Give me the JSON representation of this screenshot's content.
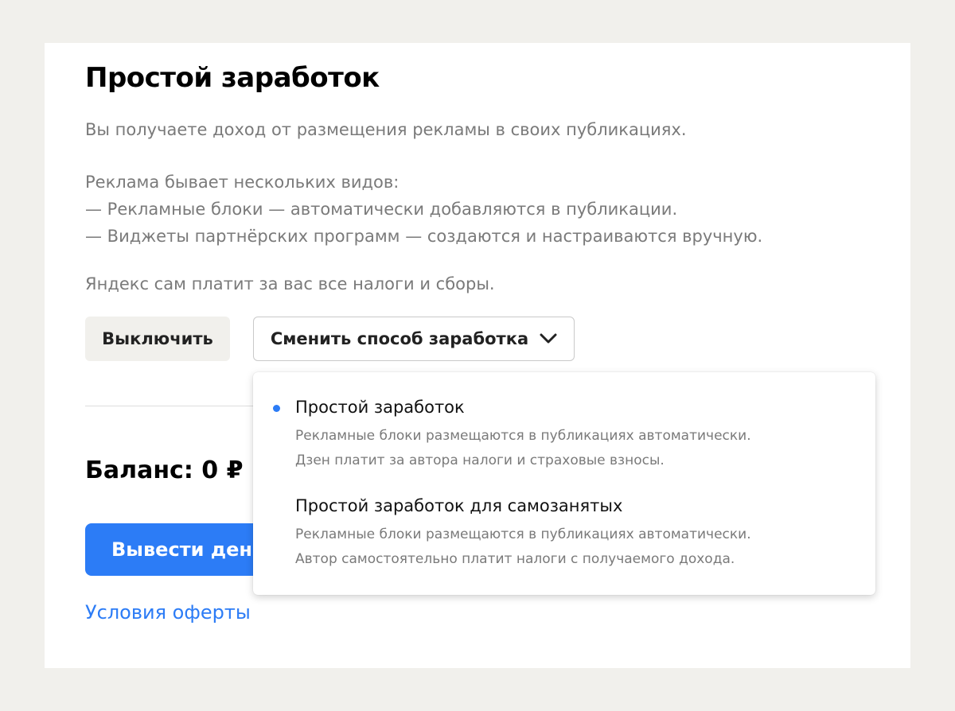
{
  "title": "Простой заработок",
  "description": {
    "intro": "Вы получаете доход от размещения рекламы в своих публикациях.",
    "types_heading": "Реклама бывает нескольких видов:",
    "type_1": "— Рекламные блоки — автоматически добавляются в публикации.",
    "type_2": "— Виджеты партнёрских программ — создаются и настраиваются вручную.",
    "taxes": "Яндекс сам платит за вас все налоги и сборы."
  },
  "buttons": {
    "disable_label": "Выключить",
    "change_method_label": "Сменить способ заработка",
    "change_method_icon": "chevron-down-icon",
    "withdraw_label": "Вывести деньги"
  },
  "balance": {
    "text": "Баланс: 0 ₽",
    "value": 0,
    "currency": "₽"
  },
  "offer_link_label": "Условия оферты",
  "dropdown": {
    "options": [
      {
        "title": "Простой заработок",
        "selected": true,
        "line_1": "Рекламные блоки размещаются в публикациях автоматически.",
        "line_2": "Дзен платит за автора налоги и страховые взносы."
      },
      {
        "title": "Простой заработок для самозанятых",
        "selected": false,
        "line_1": "Рекламные блоки размещаются в публикациях автоматически.",
        "line_2": "Автор самостоятельно платит налоги с получаемого дохода."
      }
    ]
  },
  "colors": {
    "page_background": "#f1f0ec",
    "card_background": "#ffffff",
    "accent": "#2c7cf6",
    "secondary_button": "#f1f0ec",
    "muted_text": "#7a7a7a"
  }
}
